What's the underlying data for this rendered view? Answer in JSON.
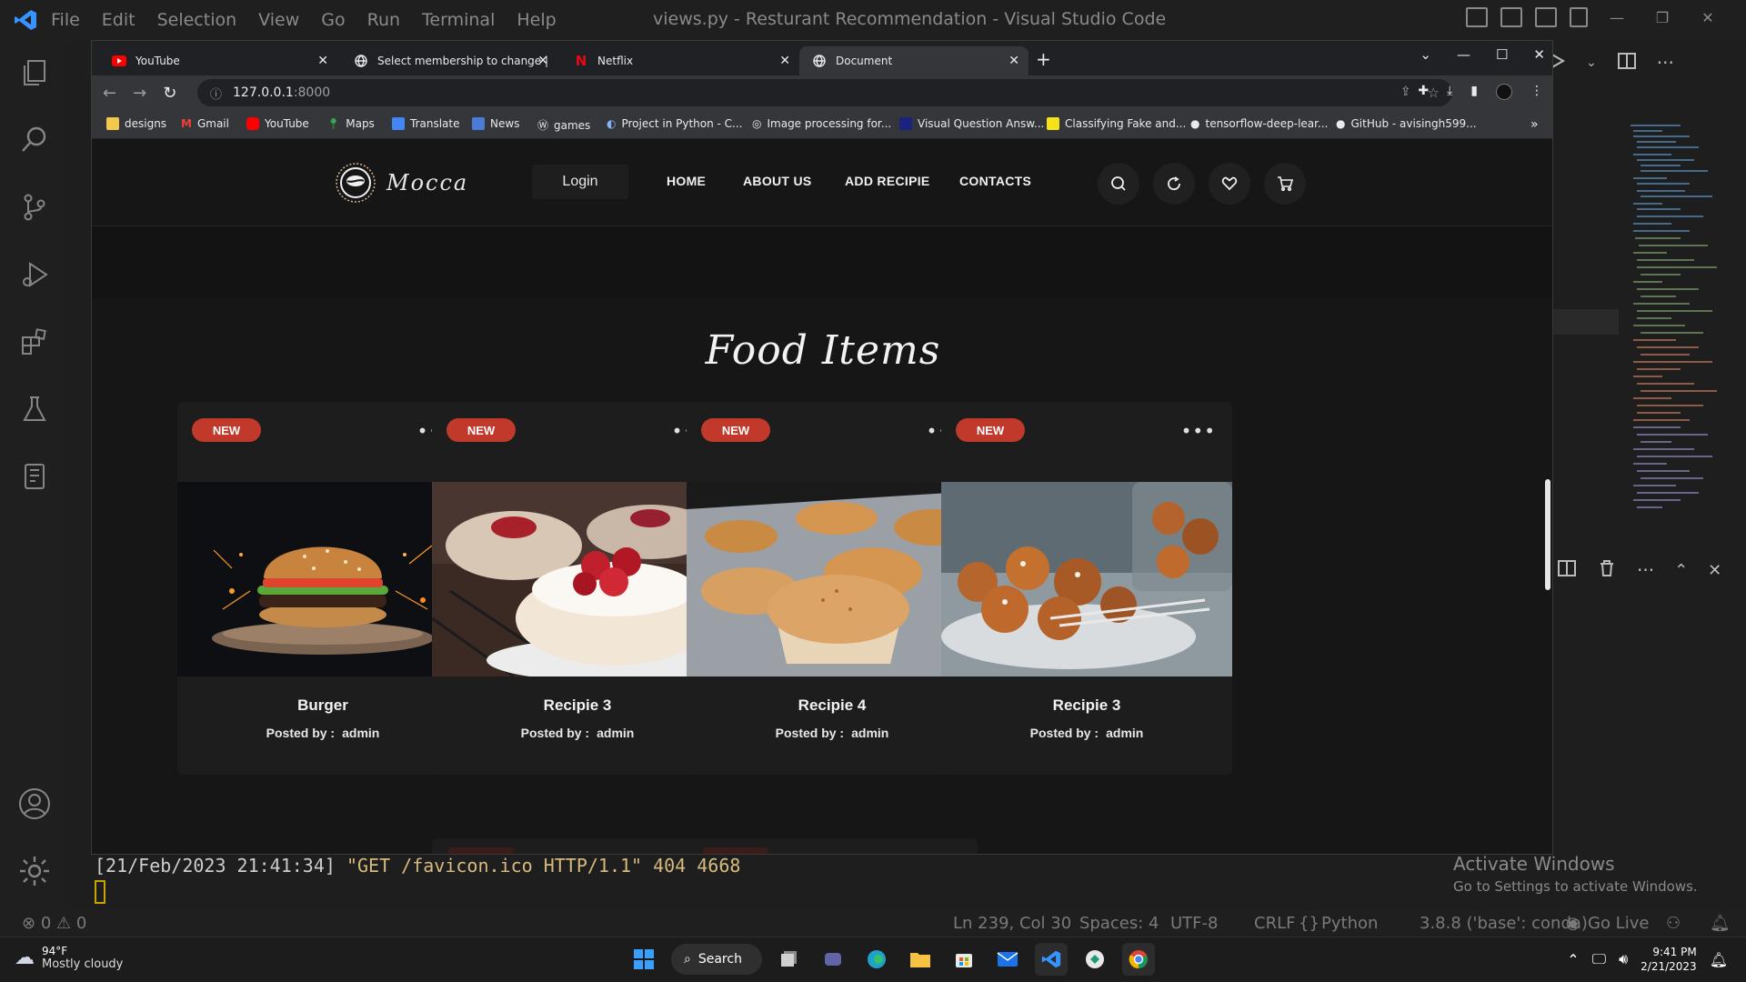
{
  "vscode": {
    "menu": [
      "File",
      "Edit",
      "Selection",
      "View",
      "Go",
      "Run",
      "Terminal",
      "Help"
    ],
    "window_title": "views.py - Resturant Recommendation - Visual Studio Code",
    "terminal_line_parts": {
      "ts": "[21/Feb/2023 21:41:34] ",
      "req": "\"GET /favicon.ico HTTP/1.1\"",
      "code": " 404 4668"
    },
    "status": {
      "problems_errors": "0",
      "problems_warnings": "0",
      "position": "Ln 239, Col 30",
      "spaces": "Spaces: 4",
      "encoding": "UTF-8",
      "eol": "CRLF",
      "language": "Python",
      "interpreter": "3.8.8 ('base': conda)",
      "golive": "Go Live"
    },
    "activate_windows": {
      "title": "Activate Windows",
      "subtitle": "Go to Settings to activate Windows."
    }
  },
  "chrome": {
    "tabs": [
      {
        "label": "YouTube",
        "icon": "youtube-icon"
      },
      {
        "label": "Select membership to change | Djan",
        "icon": "globe-icon"
      },
      {
        "label": "Netflix",
        "icon": "netflix-icon"
      },
      {
        "label": "Document",
        "icon": "globe-icon",
        "active": true
      }
    ],
    "url_host": "127.0.0.1",
    "url_port": ":8000",
    "bookmarks": [
      "designs",
      "Gmail",
      "YouTube",
      "Maps",
      "Translate",
      "News",
      "games",
      "Project in Python - C...",
      "Image processing for...",
      "Visual Question Answ...",
      "Classifying Fake and...",
      "tensorflow-deep-lear...",
      "GitHub - avisingh599..."
    ],
    "bookmarks_more": "»"
  },
  "site": {
    "brand": "Mocca",
    "login": "Login",
    "nav": [
      "HOME",
      "ABOUT US",
      "ADD RECIPIE",
      "CONTACTS"
    ],
    "section_title": "Food Items",
    "posted_by_label": "Posted by :",
    "cards": [
      {
        "badge": "NEW",
        "title": "Burger",
        "author": "admin",
        "image": "burger"
      },
      {
        "badge": "NEW",
        "title": "Recipie 3",
        "author": "admin",
        "image": "donut"
      },
      {
        "badge": "NEW",
        "title": "Recipie 4",
        "author": "admin",
        "image": "muffin"
      },
      {
        "badge": "NEW",
        "title": "Recipie 3",
        "author": "admin",
        "image": "fritters"
      }
    ]
  },
  "taskbar": {
    "weather_temp": "94°F",
    "weather_desc": "Mostly cloudy",
    "search": "Search",
    "time": "9:41 PM",
    "date": "2/21/2023"
  }
}
